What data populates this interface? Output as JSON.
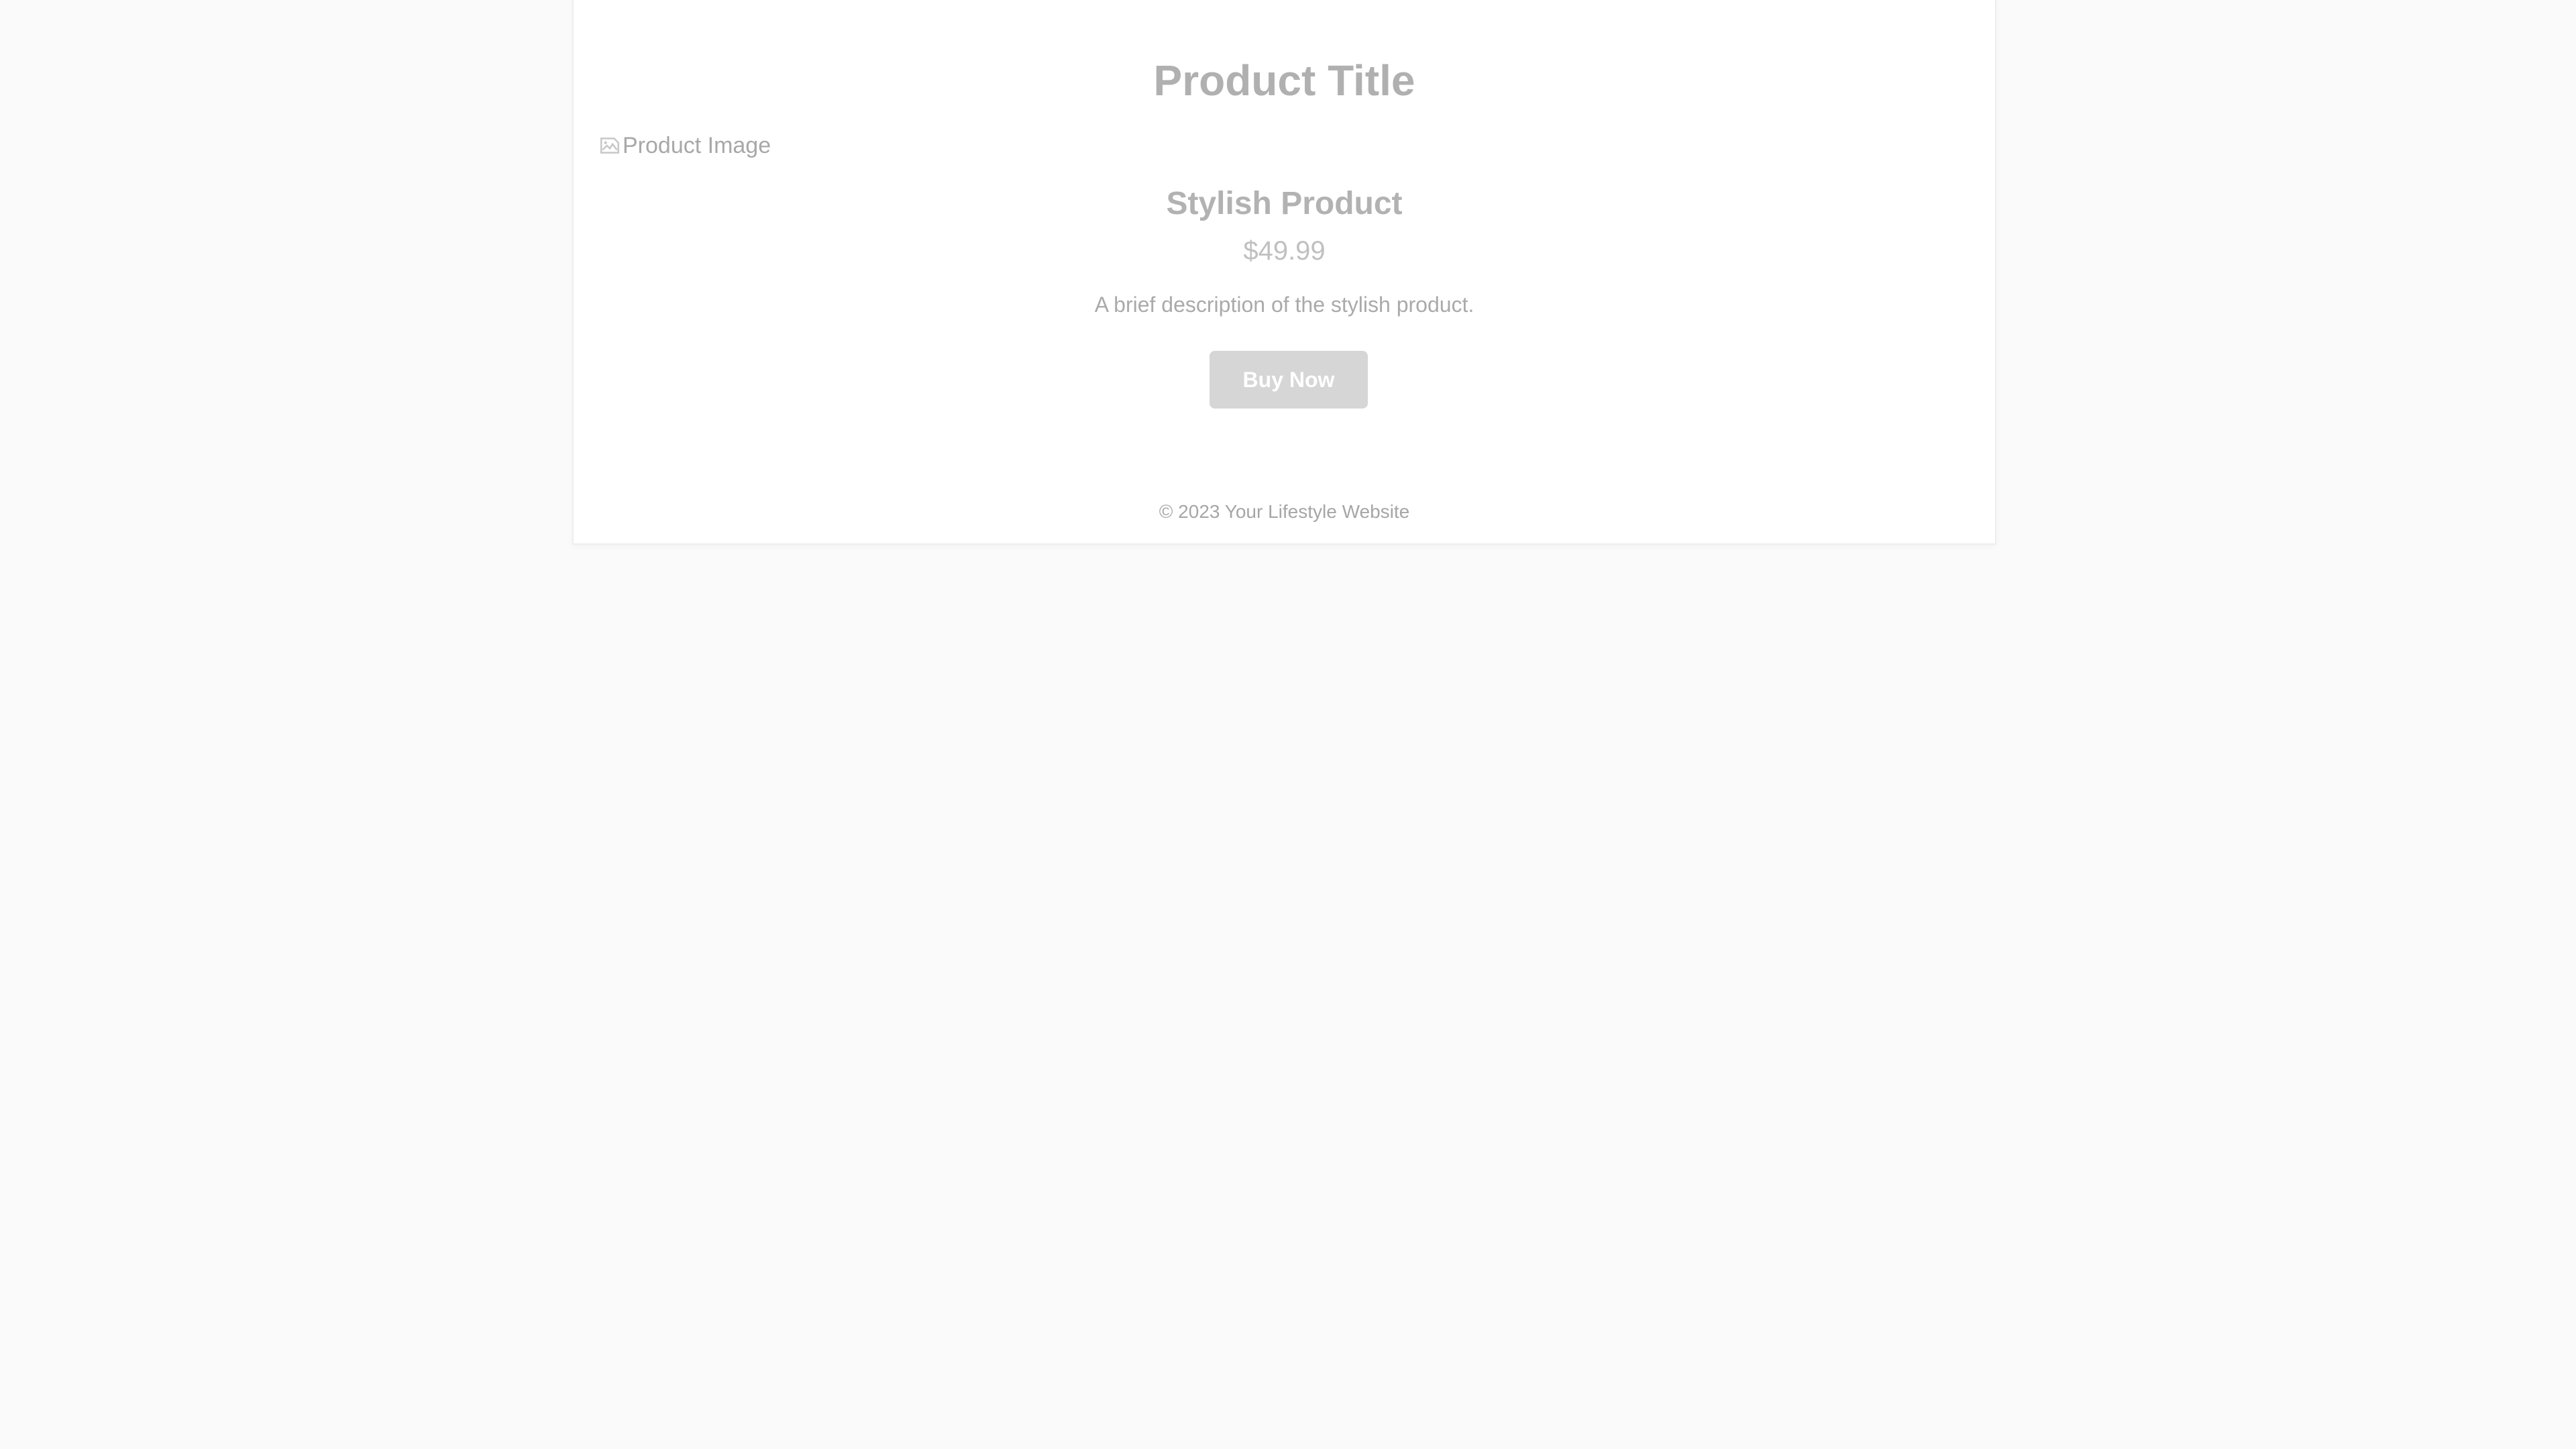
{
  "header": {
    "title": "Product Title"
  },
  "product": {
    "image_alt": "Product Image",
    "name": "Stylish Product",
    "price": "$49.99",
    "description": "A brief description of the stylish product.",
    "buy_label": "Buy Now"
  },
  "footer": {
    "text": "© 2023 Your Lifestyle Website"
  },
  "colors": {
    "page_background": "#fafafa",
    "card_background": "#ffffff",
    "button_background": "#d6d6d6",
    "button_text": "#ffffff",
    "muted_text": "#aaaaaa"
  },
  "icons": {
    "image_placeholder": "broken-image-icon"
  }
}
